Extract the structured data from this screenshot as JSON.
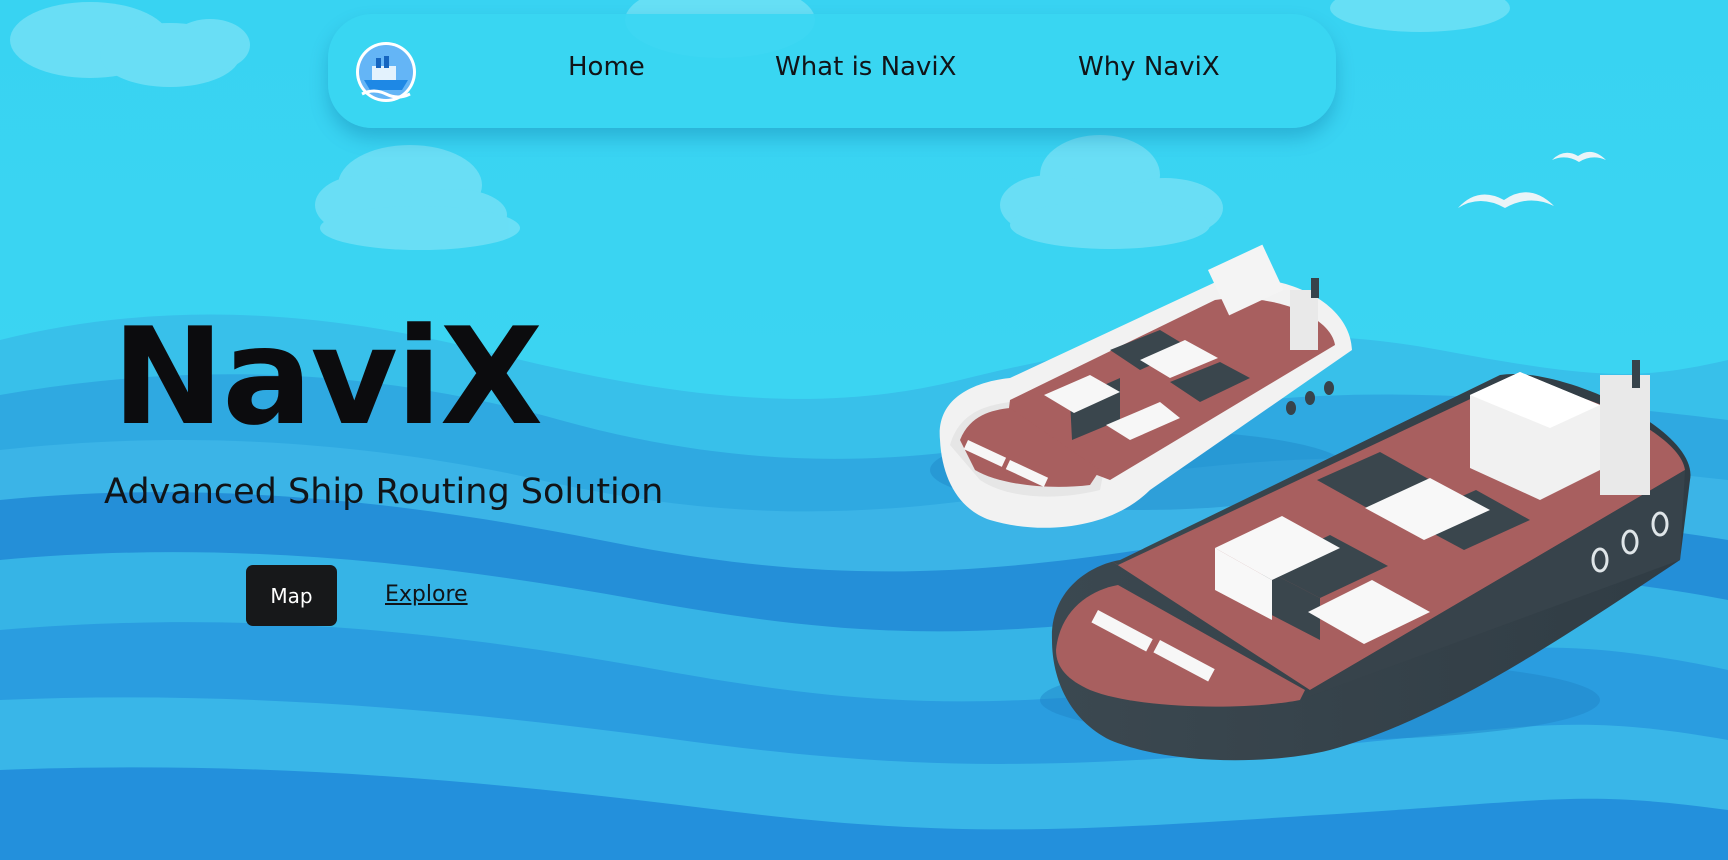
{
  "nav": {
    "logo_icon": "ship-logo-icon",
    "items": [
      {
        "label": "Home"
      },
      {
        "label": "What is NaviX"
      },
      {
        "label": "Why NaviX"
      }
    ]
  },
  "hero": {
    "title": "NaviX",
    "subtitle": "Advanced Ship Routing Solution",
    "primary_button": "Map",
    "secondary_link": "Explore"
  },
  "colors": {
    "sky": "#3ad4f2",
    "sea_light": "#35b8e6",
    "sea_dark": "#1f86d6",
    "button_bg": "#17181a",
    "deck": "#a85f5f",
    "hull_dark": "#37434b"
  }
}
